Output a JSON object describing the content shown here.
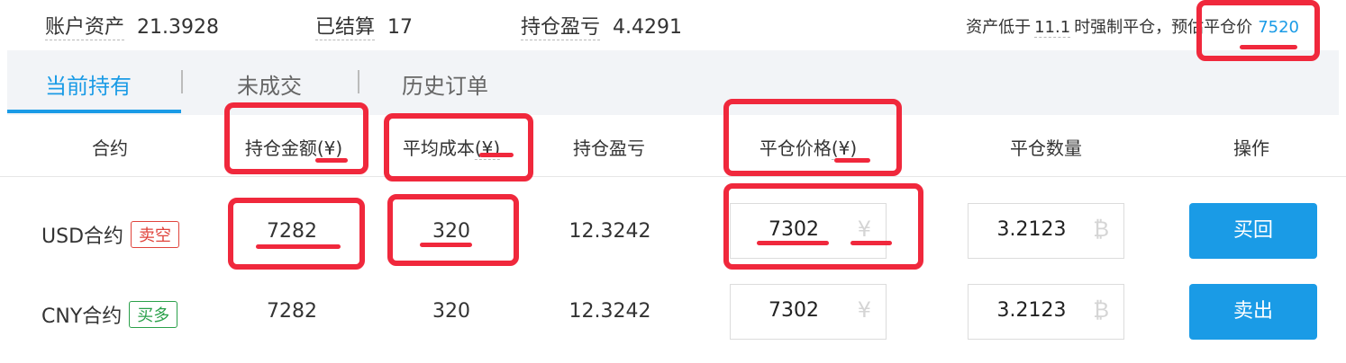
{
  "summary": {
    "asset_label": "账户资产",
    "asset_value": "21.3928",
    "settled_label": "已结算",
    "settled_value": "17",
    "pnl_label": "持仓盈亏",
    "pnl_value": "4.4291",
    "force_close_prefix": "资产低于",
    "force_close_threshold": "11.1",
    "force_close_middle": "时强制平仓，预估平仓价",
    "force_close_price": "7520"
  },
  "tabs": [
    {
      "label": "当前持有",
      "active": true
    },
    {
      "label": "未成交",
      "active": false
    },
    {
      "label": "历史订单",
      "active": false
    }
  ],
  "table": {
    "headers": {
      "contract": "合约",
      "position_amount": "持仓金额",
      "position_amount_unit": "(¥)",
      "avg_cost": "平均成本",
      "avg_cost_unit": "(¥)",
      "pnl": "持仓盈亏",
      "close_price": "平仓价格",
      "close_price_unit": "(¥)",
      "close_qty": "平仓数量",
      "action": "操作"
    },
    "rows": [
      {
        "contract": "USD合约",
        "side": "卖空",
        "amount": "7282",
        "avg_cost": "320",
        "pnl": "12.3242",
        "close_price": "7302",
        "price_symbol": "¥",
        "close_qty": "3.2123",
        "qty_symbol": "₿",
        "action": "买回"
      },
      {
        "contract": "CNY合约",
        "side": "买多",
        "amount": "7282",
        "avg_cost": "320",
        "pnl": "12.3242",
        "close_price": "7302",
        "price_symbol": "¥",
        "close_qty": "3.2123",
        "qty_symbol": "₿",
        "action": "卖出"
      }
    ]
  },
  "colors": {
    "accent": "#1a9be6",
    "short_tag": "#e0443c",
    "long_tag": "#2aa04a",
    "annotation": "#f0283c"
  }
}
